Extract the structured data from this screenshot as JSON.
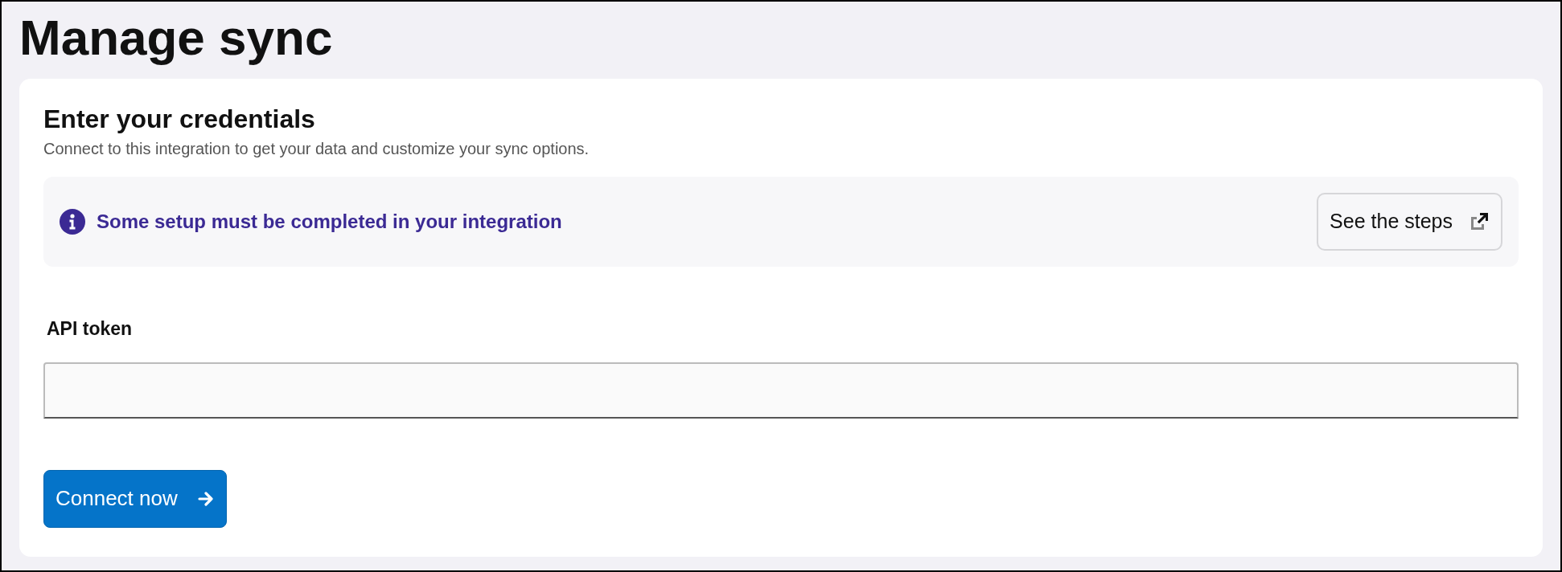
{
  "page": {
    "title": "Manage sync"
  },
  "card": {
    "title": "Enter your credentials",
    "subtitle": "Connect to this integration to get your data and customize your sync options."
  },
  "notice": {
    "message": "Some setup must be completed in your integration",
    "button": "See the steps"
  },
  "field": {
    "label": "API token"
  },
  "submit": {
    "label": "Connect now",
    "disabled": false
  }
}
